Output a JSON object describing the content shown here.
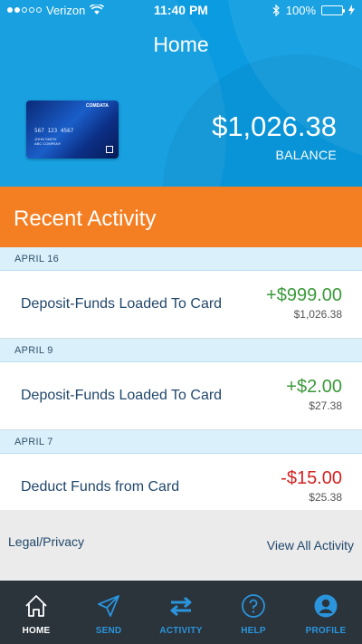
{
  "status_bar": {
    "carrier": "Verizon",
    "time": "11:40 PM",
    "battery_percent": "100%",
    "icons": [
      "signal-dots-icon",
      "wifi-icon",
      "bluetooth-icon",
      "battery-icon",
      "charging-bolt-icon"
    ]
  },
  "header": {
    "title": "Home"
  },
  "card": {
    "brand": "COMDATA",
    "number": "567  123  4567",
    "holder": "JOHN SMITH",
    "company": "ABC COMPANY"
  },
  "balance": {
    "amount": "$1,026.38",
    "label": "BALANCE"
  },
  "recent": {
    "title": "Recent Activity"
  },
  "activity": [
    {
      "date": "APRIL 16",
      "description": "Deposit-Funds Loaded To Card",
      "amount": "+$999.00",
      "running_balance": "$1,026.38",
      "type": "credit"
    },
    {
      "date": "APRIL 9",
      "description": "Deposit-Funds Loaded To Card",
      "amount": "+$2.00",
      "running_balance": "$27.38",
      "type": "credit"
    },
    {
      "date": "APRIL 7",
      "description": "Deduct Funds from Card",
      "amount": "-$15.00",
      "running_balance": "$25.38",
      "type": "debit"
    }
  ],
  "footer": {
    "legal_label": "Legal/Privacy",
    "view_all_label": "View All Activity"
  },
  "tabs": [
    {
      "label": "HOME",
      "icon": "home-icon",
      "active": true
    },
    {
      "label": "SEND",
      "icon": "send-icon",
      "active": false
    },
    {
      "label": "ACTIVITY",
      "icon": "activity-icon",
      "active": false
    },
    {
      "label": "HELP",
      "icon": "help-icon",
      "active": false
    },
    {
      "label": "PROFILE",
      "icon": "profile-icon",
      "active": false
    }
  ],
  "colors": {
    "hero_blue": "#0a9be0",
    "recent_orange": "#f47f23",
    "credit_green": "#3a9a3a",
    "debit_red": "#d32222",
    "tab_bar": "#2b333b",
    "tab_accent": "#2a95dc"
  }
}
